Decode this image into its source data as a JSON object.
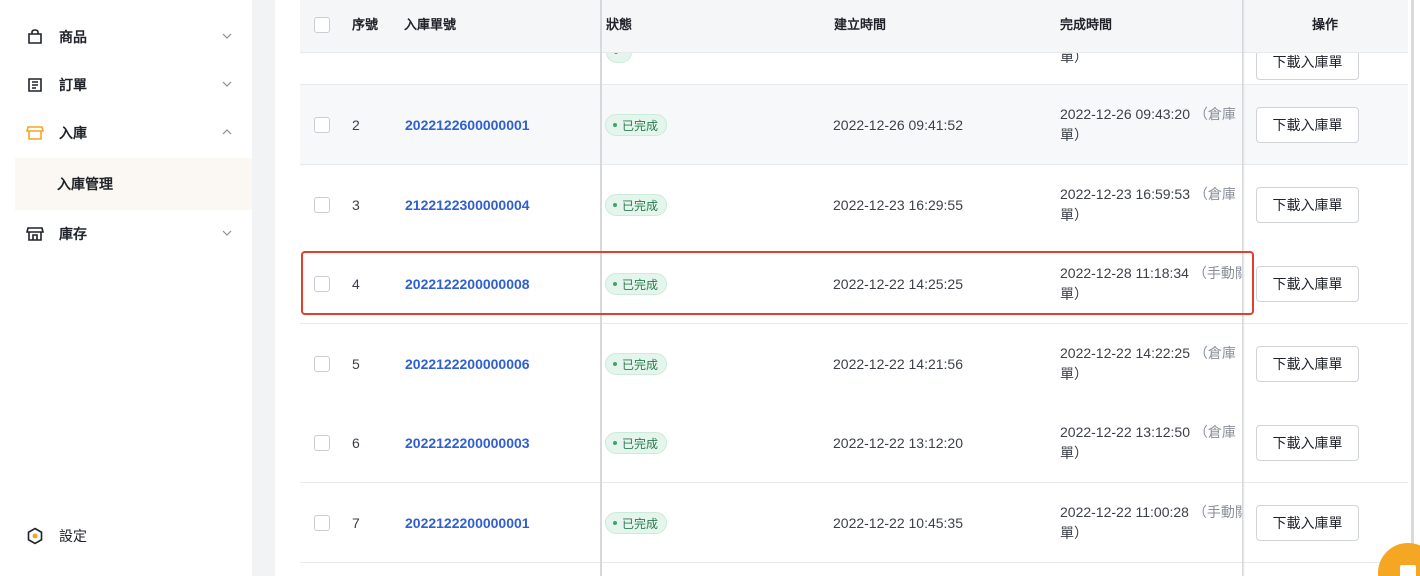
{
  "sidebar": {
    "items": [
      {
        "label": "商品",
        "icon": "shopping-bag-icon",
        "expanded": false
      },
      {
        "label": "訂單",
        "icon": "order-list-icon",
        "expanded": false
      },
      {
        "label": "入庫",
        "icon": "store-icon",
        "expanded": true
      },
      {
        "label": "庫存",
        "icon": "warehouse-icon",
        "expanded": false
      }
    ],
    "sub_item": "入庫管理",
    "settings_label": "設定",
    "active_color": "#f5a623"
  },
  "table": {
    "headers": {
      "index": "序號",
      "order_no": "入庫單號",
      "status": "狀態",
      "created": "建立時間",
      "completed": "完成時間",
      "actions": "操作"
    },
    "top_partial": {
      "completed_tail": "單）",
      "button": "下載入庫單"
    },
    "rows": [
      {
        "index": "2",
        "order_no": "2022122600000001",
        "status": "已完成",
        "created": "2022-12-26 09:41:52",
        "completed_time": "2022-12-26 09:43:20",
        "completed_note": "（倉庫",
        "completed_tail": "單）",
        "button": "下載入庫單"
      },
      {
        "index": "3",
        "order_no": "2122122300000004",
        "status": "已完成",
        "created": "2022-12-23 16:29:55",
        "completed_time": "2022-12-23 16:59:53",
        "completed_note": "（倉庫",
        "completed_tail": "單）",
        "button": "下載入庫單"
      },
      {
        "index": "4",
        "order_no": "2022122200000008",
        "status": "已完成",
        "created": "2022-12-22 14:25:25",
        "completed_time": "2022-12-28 11:18:34",
        "completed_note": "（手動關",
        "completed_tail": "單）",
        "button": "下載入庫單"
      },
      {
        "index": "5",
        "order_no": "2022122200000006",
        "status": "已完成",
        "created": "2022-12-22 14:21:56",
        "completed_time": "2022-12-22 14:22:25",
        "completed_note": "（倉庫",
        "completed_tail": "單）",
        "button": "下載入庫單"
      },
      {
        "index": "6",
        "order_no": "2022122200000003",
        "status": "已完成",
        "created": "2022-12-22 13:12:20",
        "completed_time": "2022-12-22 13:12:50",
        "completed_note": "（倉庫",
        "completed_tail": "單）",
        "button": "下載入庫單"
      },
      {
        "index": "7",
        "order_no": "2022122200000001",
        "status": "已完成",
        "created": "2022-12-22 10:45:35",
        "completed_time": "2022-12-22 11:00:28",
        "completed_note": "（手動關",
        "completed_tail": "單）",
        "button": "下載入庫單"
      }
    ]
  },
  "colors": {
    "link": "#2f5fd3",
    "status_bg": "#e3f5ec",
    "status_text": "#2d7a4e",
    "highlight": "#e0402c"
  }
}
